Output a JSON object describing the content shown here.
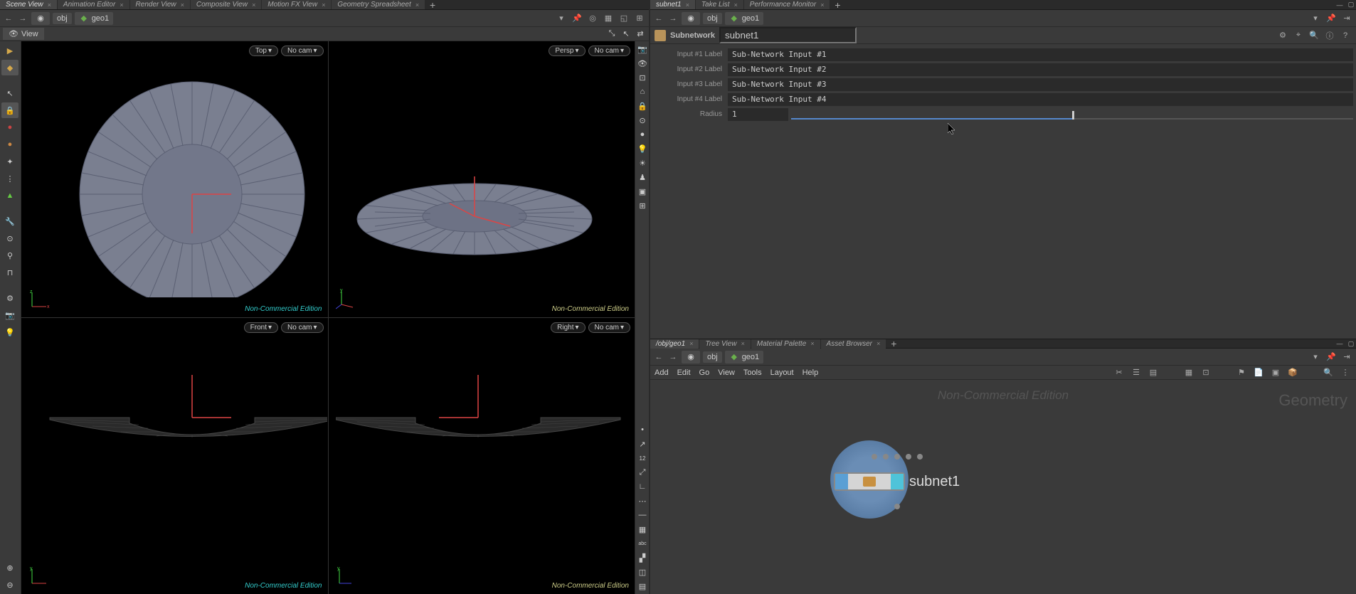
{
  "left_tabs": [
    "Scene View",
    "Animation Editor",
    "Render View",
    "Composite View",
    "Motion FX View",
    "Geometry Spreadsheet"
  ],
  "right_top_tabs": [
    "subnet1",
    "Take List",
    "Performance Monitor"
  ],
  "path_left": {
    "seg1": "obj",
    "seg2": "geo1"
  },
  "path_right_top": {
    "seg1": "obj",
    "seg2": "geo1"
  },
  "view_button": "View",
  "viewports": {
    "top_left": {
      "view": "Top",
      "cam": "No cam",
      "watermark": "Non-Commercial Edition"
    },
    "top_right": {
      "view": "Persp",
      "cam": "No cam",
      "watermark": "Non-Commercial Edition"
    },
    "bottom_left": {
      "view": "Front",
      "cam": "No cam",
      "watermark": "Non-Commercial Edition"
    },
    "bottom_right": {
      "view": "Right",
      "cam": "No cam",
      "watermark": "Non-Commercial Edition"
    }
  },
  "param": {
    "type": "Subnetwork",
    "name": "subnet1",
    "rows": {
      "label1": "Input #1 Label",
      "val1": "Sub-Network Input #1",
      "label2": "Input #2 Label",
      "val2": "Sub-Network Input #2",
      "label3": "Input #3 Label",
      "val3": "Sub-Network Input #3",
      "label4": "Input #4 Label",
      "val4": "Sub-Network Input #4",
      "radius_label": "Radius",
      "radius_val": "1"
    }
  },
  "network_tabs": [
    "/obj/geo1",
    "Tree View",
    "Material Palette",
    "Asset Browser"
  ],
  "net_path": {
    "seg1": "obj",
    "seg2": "geo1"
  },
  "net_menu": [
    "Add",
    "Edit",
    "Go",
    "View",
    "Tools",
    "Layout",
    "Help"
  ],
  "network": {
    "watermark1": "Non-Commercial Edition",
    "watermark2": "Geometry",
    "node_name": "subnet1"
  }
}
